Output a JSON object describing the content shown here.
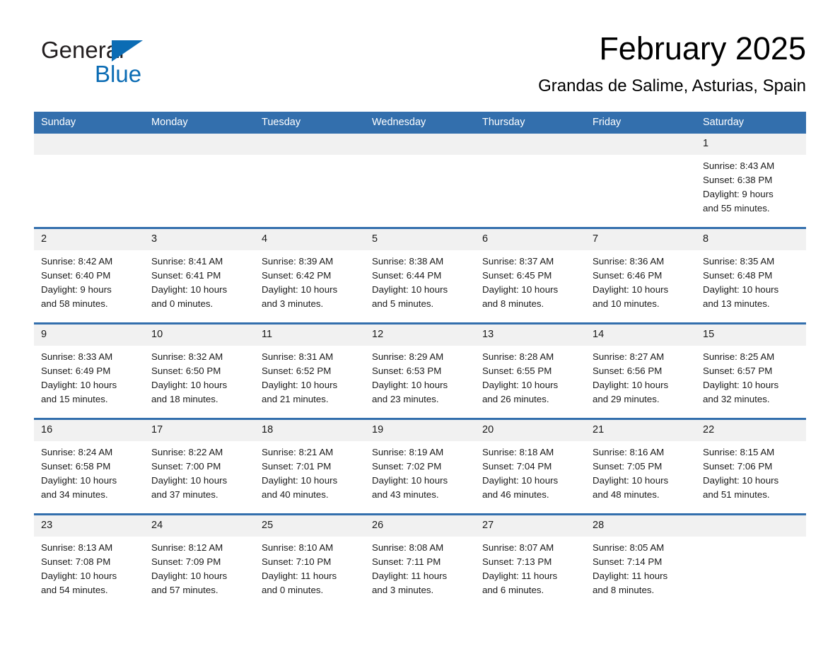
{
  "brand": {
    "name_part1": "General",
    "name_part2": "Blue",
    "logo_icon": "triangle-logo-icon",
    "accent_color": "#0b6cb4"
  },
  "header": {
    "month_title": "February 2025",
    "location": "Grandas de Salime, Asturias, Spain"
  },
  "calendar": {
    "header_color": "#336fad",
    "daynum_bg": "#f1f1f1",
    "weekdays": [
      "Sunday",
      "Monday",
      "Tuesday",
      "Wednesday",
      "Thursday",
      "Friday",
      "Saturday"
    ],
    "weeks": [
      [
        {
          "date": "",
          "blank": true
        },
        {
          "date": "",
          "blank": true
        },
        {
          "date": "",
          "blank": true
        },
        {
          "date": "",
          "blank": true
        },
        {
          "date": "",
          "blank": true
        },
        {
          "date": "",
          "blank": true
        },
        {
          "date": "1",
          "sunrise": "Sunrise: 8:43 AM",
          "sunset": "Sunset: 6:38 PM",
          "daylight1": "Daylight: 9 hours",
          "daylight2": "and 55 minutes."
        }
      ],
      [
        {
          "date": "2",
          "sunrise": "Sunrise: 8:42 AM",
          "sunset": "Sunset: 6:40 PM",
          "daylight1": "Daylight: 9 hours",
          "daylight2": "and 58 minutes."
        },
        {
          "date": "3",
          "sunrise": "Sunrise: 8:41 AM",
          "sunset": "Sunset: 6:41 PM",
          "daylight1": "Daylight: 10 hours",
          "daylight2": "and 0 minutes."
        },
        {
          "date": "4",
          "sunrise": "Sunrise: 8:39 AM",
          "sunset": "Sunset: 6:42 PM",
          "daylight1": "Daylight: 10 hours",
          "daylight2": "and 3 minutes."
        },
        {
          "date": "5",
          "sunrise": "Sunrise: 8:38 AM",
          "sunset": "Sunset: 6:44 PM",
          "daylight1": "Daylight: 10 hours",
          "daylight2": "and 5 minutes."
        },
        {
          "date": "6",
          "sunrise": "Sunrise: 8:37 AM",
          "sunset": "Sunset: 6:45 PM",
          "daylight1": "Daylight: 10 hours",
          "daylight2": "and 8 minutes."
        },
        {
          "date": "7",
          "sunrise": "Sunrise: 8:36 AM",
          "sunset": "Sunset: 6:46 PM",
          "daylight1": "Daylight: 10 hours",
          "daylight2": "and 10 minutes."
        },
        {
          "date": "8",
          "sunrise": "Sunrise: 8:35 AM",
          "sunset": "Sunset: 6:48 PM",
          "daylight1": "Daylight: 10 hours",
          "daylight2": "and 13 minutes."
        }
      ],
      [
        {
          "date": "9",
          "sunrise": "Sunrise: 8:33 AM",
          "sunset": "Sunset: 6:49 PM",
          "daylight1": "Daylight: 10 hours",
          "daylight2": "and 15 minutes."
        },
        {
          "date": "10",
          "sunrise": "Sunrise: 8:32 AM",
          "sunset": "Sunset: 6:50 PM",
          "daylight1": "Daylight: 10 hours",
          "daylight2": "and 18 minutes."
        },
        {
          "date": "11",
          "sunrise": "Sunrise: 8:31 AM",
          "sunset": "Sunset: 6:52 PM",
          "daylight1": "Daylight: 10 hours",
          "daylight2": "and 21 minutes."
        },
        {
          "date": "12",
          "sunrise": "Sunrise: 8:29 AM",
          "sunset": "Sunset: 6:53 PM",
          "daylight1": "Daylight: 10 hours",
          "daylight2": "and 23 minutes."
        },
        {
          "date": "13",
          "sunrise": "Sunrise: 8:28 AM",
          "sunset": "Sunset: 6:55 PM",
          "daylight1": "Daylight: 10 hours",
          "daylight2": "and 26 minutes."
        },
        {
          "date": "14",
          "sunrise": "Sunrise: 8:27 AM",
          "sunset": "Sunset: 6:56 PM",
          "daylight1": "Daylight: 10 hours",
          "daylight2": "and 29 minutes."
        },
        {
          "date": "15",
          "sunrise": "Sunrise: 8:25 AM",
          "sunset": "Sunset: 6:57 PM",
          "daylight1": "Daylight: 10 hours",
          "daylight2": "and 32 minutes."
        }
      ],
      [
        {
          "date": "16",
          "sunrise": "Sunrise: 8:24 AM",
          "sunset": "Sunset: 6:58 PM",
          "daylight1": "Daylight: 10 hours",
          "daylight2": "and 34 minutes."
        },
        {
          "date": "17",
          "sunrise": "Sunrise: 8:22 AM",
          "sunset": "Sunset: 7:00 PM",
          "daylight1": "Daylight: 10 hours",
          "daylight2": "and 37 minutes."
        },
        {
          "date": "18",
          "sunrise": "Sunrise: 8:21 AM",
          "sunset": "Sunset: 7:01 PM",
          "daylight1": "Daylight: 10 hours",
          "daylight2": "and 40 minutes."
        },
        {
          "date": "19",
          "sunrise": "Sunrise: 8:19 AM",
          "sunset": "Sunset: 7:02 PM",
          "daylight1": "Daylight: 10 hours",
          "daylight2": "and 43 minutes."
        },
        {
          "date": "20",
          "sunrise": "Sunrise: 8:18 AM",
          "sunset": "Sunset: 7:04 PM",
          "daylight1": "Daylight: 10 hours",
          "daylight2": "and 46 minutes."
        },
        {
          "date": "21",
          "sunrise": "Sunrise: 8:16 AM",
          "sunset": "Sunset: 7:05 PM",
          "daylight1": "Daylight: 10 hours",
          "daylight2": "and 48 minutes."
        },
        {
          "date": "22",
          "sunrise": "Sunrise: 8:15 AM",
          "sunset": "Sunset: 7:06 PM",
          "daylight1": "Daylight: 10 hours",
          "daylight2": "and 51 minutes."
        }
      ],
      [
        {
          "date": "23",
          "sunrise": "Sunrise: 8:13 AM",
          "sunset": "Sunset: 7:08 PM",
          "daylight1": "Daylight: 10 hours",
          "daylight2": "and 54 minutes."
        },
        {
          "date": "24",
          "sunrise": "Sunrise: 8:12 AM",
          "sunset": "Sunset: 7:09 PM",
          "daylight1": "Daylight: 10 hours",
          "daylight2": "and 57 minutes."
        },
        {
          "date": "25",
          "sunrise": "Sunrise: 8:10 AM",
          "sunset": "Sunset: 7:10 PM",
          "daylight1": "Daylight: 11 hours",
          "daylight2": "and 0 minutes."
        },
        {
          "date": "26",
          "sunrise": "Sunrise: 8:08 AM",
          "sunset": "Sunset: 7:11 PM",
          "daylight1": "Daylight: 11 hours",
          "daylight2": "and 3 minutes."
        },
        {
          "date": "27",
          "sunrise": "Sunrise: 8:07 AM",
          "sunset": "Sunset: 7:13 PM",
          "daylight1": "Daylight: 11 hours",
          "daylight2": "and 6 minutes."
        },
        {
          "date": "28",
          "sunrise": "Sunrise: 8:05 AM",
          "sunset": "Sunset: 7:14 PM",
          "daylight1": "Daylight: 11 hours",
          "daylight2": "and 8 minutes."
        },
        {
          "date": "",
          "blank": true,
          "trailing": true
        }
      ]
    ]
  }
}
